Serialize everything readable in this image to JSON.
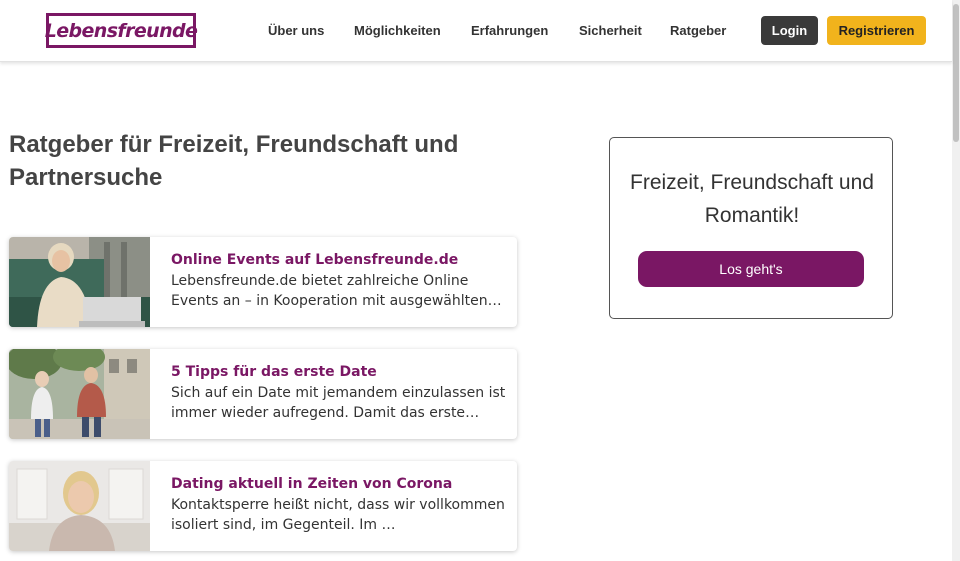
{
  "header": {
    "logo_text": "Lebensfreunde",
    "nav": [
      {
        "label": "Über uns"
      },
      {
        "label": "Möglichkeiten"
      },
      {
        "label": "Erfahrungen"
      },
      {
        "label": "Sicherheit"
      },
      {
        "label": "Ratgeber"
      }
    ],
    "login_label": "Login",
    "register_label": "Registrieren"
  },
  "main": {
    "title": "Ratgeber für Freizeit, Freundschaft und Partnersuche",
    "articles": [
      {
        "title": "Online Events auf Lebensfreunde.de",
        "text": "Lebensfreunde.de bietet zahlreiche Online Events an – in Kooperation mit ausgewählten Partnern …",
        "image": "woman-on-sofa-with-laptop-photo"
      },
      {
        "title": "5 Tipps für das erste Date",
        "text": "Sich auf ein Date mit jemandem einzulassen ist immer wieder aufregend. Damit das erste Treffen …",
        "image": "senior-couple-walking-photo"
      },
      {
        "title": "Dating aktuell in Zeiten von Corona",
        "text": "Kontaktsperre heißt nicht, dass wir vollkommen isoliert sind, im Gegenteil. Im …",
        "image": "smiling-blonde-woman-photo"
      }
    ]
  },
  "sidebar": {
    "heading": "Freizeit, Freundschaft und Romantik!",
    "button_label": "Los geht's"
  },
  "colors": {
    "brand": "#7a1764",
    "accent": "#f1b31c",
    "dark_button": "#3a3a3a"
  }
}
